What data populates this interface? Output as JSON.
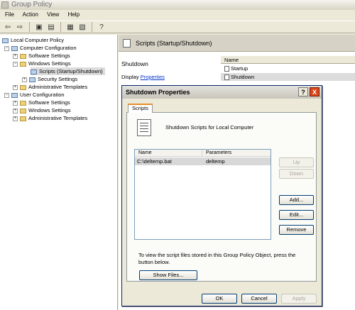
{
  "window": {
    "title": "Group Policy"
  },
  "menu": [
    "File",
    "Action",
    "View",
    "Help"
  ],
  "toolbar": [
    "back-icon",
    "forward-icon",
    "up-folder-icon",
    "show-tree-icon",
    "properties-icon",
    "export-icon",
    "help-icon"
  ],
  "tree": {
    "root": "Local Computer Policy",
    "computer_configuration": "Computer Configuration",
    "software_settings_1": "Software Settings",
    "windows_settings_1": "Windows Settings",
    "scripts": "Scripts (Startup/Shutdown)",
    "security_settings": "Security Settings",
    "admin_templates_1": "Administrative Templates",
    "user_configuration": "User Configuration",
    "software_settings_2": "Software Settings",
    "windows_settings_2": "Windows Settings",
    "admin_templates_2": "Administrative Templates"
  },
  "right_pane": {
    "header": "Scripts (Startup/Shutdown)",
    "title": "Shutdown",
    "display_prefix": "Display",
    "properties_link": "Properties",
    "list_header": "Name",
    "items": [
      "Startup",
      "Shutdown"
    ]
  },
  "dialog": {
    "title": "Shutdown Properties",
    "help_label": "?",
    "close_label": "X",
    "tab": "Scripts",
    "heading": "Shutdown Scripts for Local Computer",
    "columns": {
      "name": "Name",
      "parameters": "Parameters"
    },
    "row": {
      "name": "C:\\deltemp.bat",
      "parameters": "deltemp"
    },
    "buttons": {
      "up": "Up",
      "down": "Down",
      "add": "Add...",
      "edit": "Edit...",
      "remove": "Remove"
    },
    "note": "To view the script files stored in this Group Policy Object, press the button below.",
    "show_files": "Show Files...",
    "ok": "OK",
    "cancel": "Cancel",
    "apply": "Apply"
  }
}
